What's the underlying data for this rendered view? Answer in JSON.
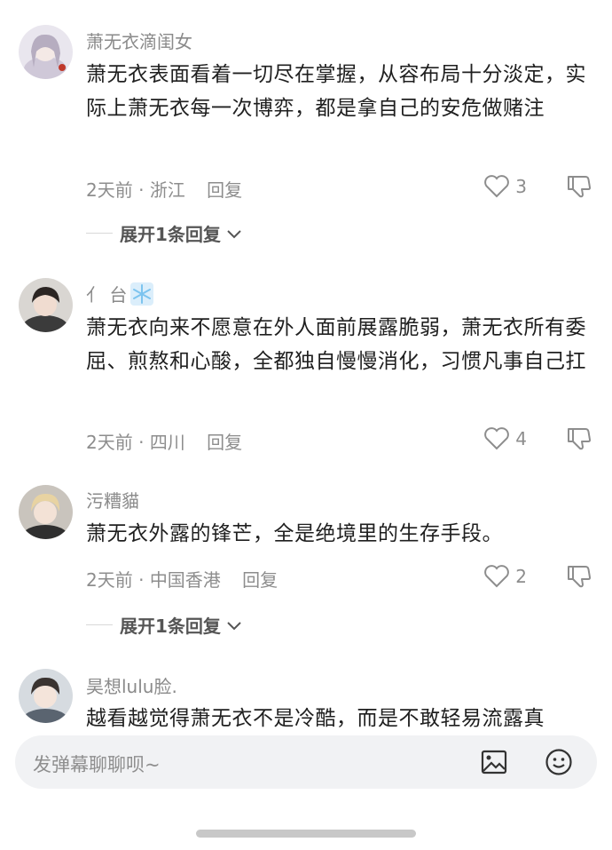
{
  "comments": [
    {
      "user": "萧无衣滴闺女",
      "text": "萧无衣表面看着一切尽在掌握，从容布局十分淡定，实际上萧无衣每一次博弈，都是拿自己的安危做赌注",
      "time": "2天前",
      "location": "浙江",
      "reply": "回复",
      "likes": "3",
      "expand": "展开1条回复"
    },
    {
      "user": "⺅ 台",
      "text": "萧无衣向来不愿意在外人面前展露脆弱，萧无衣所有委屈、煎熬和心酸，全都独自慢慢消化，习惯凡事自己扛",
      "time": "2天前",
      "location": "四川",
      "reply": "回复",
      "likes": "4"
    },
    {
      "user": "污糟貓",
      "text": "萧无衣外露的锋芒，全是绝境里的生存手段。",
      "time": "2天前",
      "location": "中国香港",
      "reply": "回复",
      "likes": "2",
      "expand": "展开1条回复"
    },
    {
      "user": "昊想lulu脸.",
      "text": "越看越觉得萧无衣不是冷酷，而是不敢轻易流露真"
    }
  ],
  "dot": "·",
  "input": {
    "placeholder": "发弹幕聊聊呗~"
  },
  "icons": {
    "like": "heart-outline-icon",
    "dislike": "thumbs-down-icon",
    "image": "image-icon",
    "emoji": "smiley-icon",
    "snow": "snowflake-icon",
    "chevron": "chevron-down-icon"
  }
}
